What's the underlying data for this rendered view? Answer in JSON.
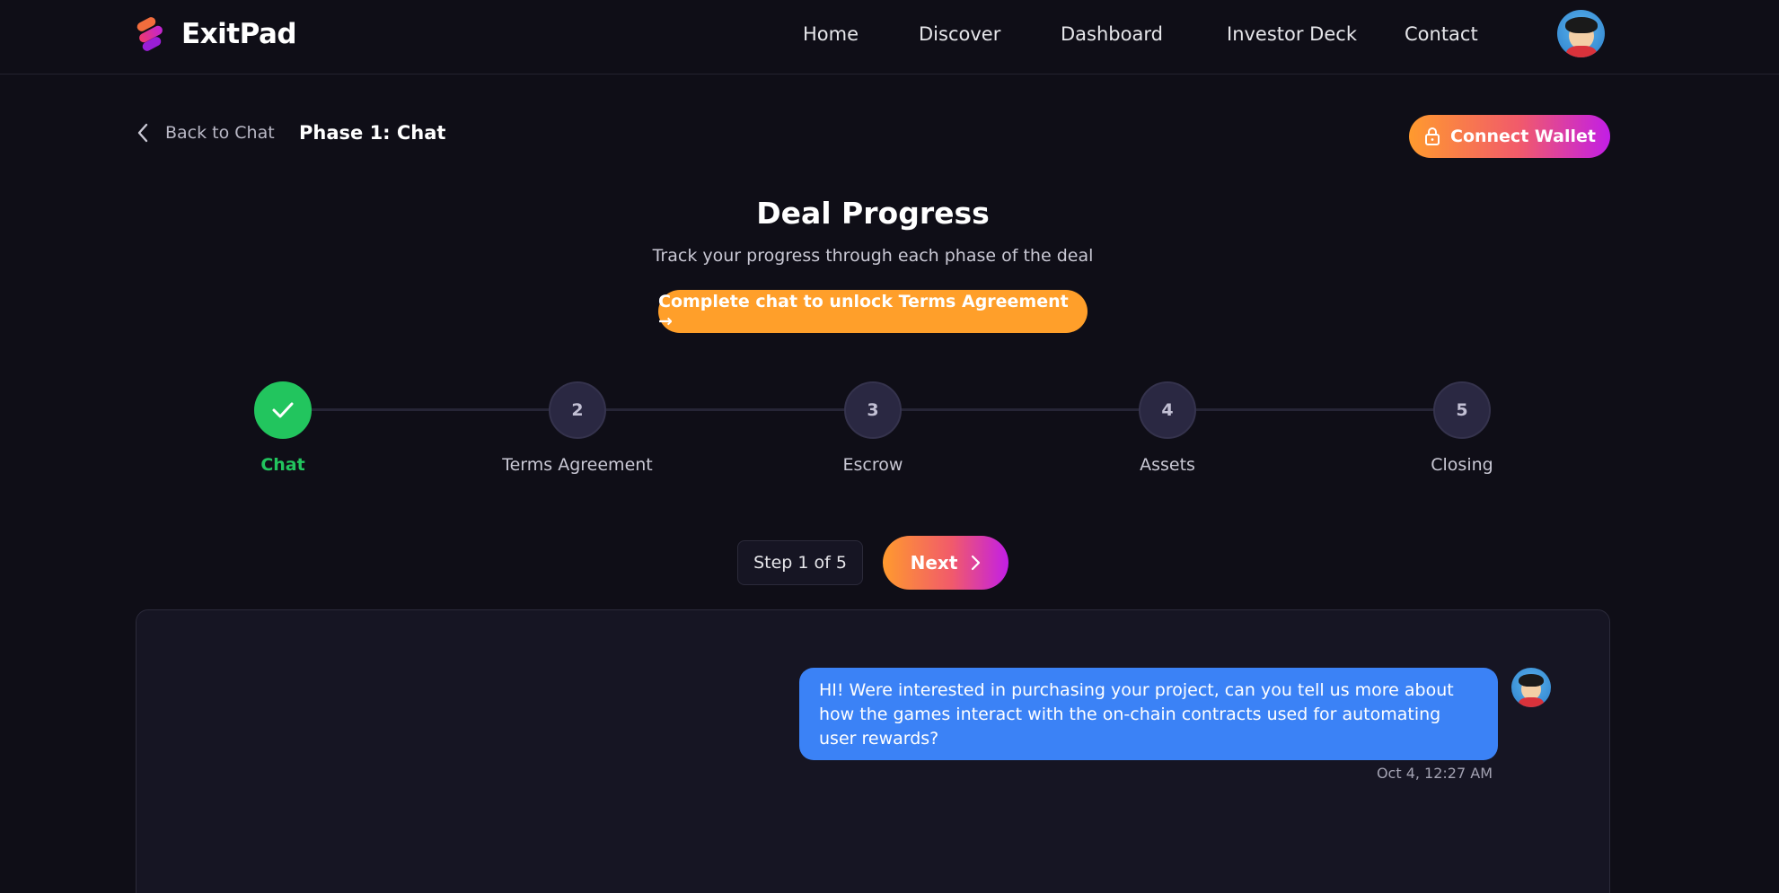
{
  "header": {
    "brand": "ExitPad",
    "nav": [
      "Home",
      "Discover",
      "Dashboard",
      "Investor Deck",
      "Contact"
    ]
  },
  "subheader": {
    "back_label": "Back to Chat",
    "phase_title": "Phase 1: Chat",
    "wallet_label": "Connect Wallet"
  },
  "progress": {
    "title": "Deal Progress",
    "subtitle": "Track your progress through each phase of the deal",
    "unlock_label": "Complete chat to unlock Terms Agreement →",
    "steps": [
      {
        "number": "1",
        "label": "Chat",
        "status": "done"
      },
      {
        "number": "2",
        "label": "Terms Agreement",
        "status": "pending"
      },
      {
        "number": "3",
        "label": "Escrow",
        "status": "pending"
      },
      {
        "number": "4",
        "label": "Assets",
        "status": "pending"
      },
      {
        "number": "5",
        "label": "Closing",
        "status": "pending"
      }
    ],
    "step_count": "Step 1 of 5",
    "next_label": "Next"
  },
  "chat": {
    "messages": [
      {
        "text": "HI! Were interested in purchasing your project, can you tell us more about how the games interact with the on-chain contracts used for automating user rewards?",
        "time": "Oct 4, 12:27 AM"
      }
    ]
  },
  "colors": {
    "background": "#0f0e17",
    "accent_orange": "#ff9f2a",
    "accent_purple": "#c21ee6",
    "success": "#22c55e",
    "message_blue": "#3b82f6"
  }
}
